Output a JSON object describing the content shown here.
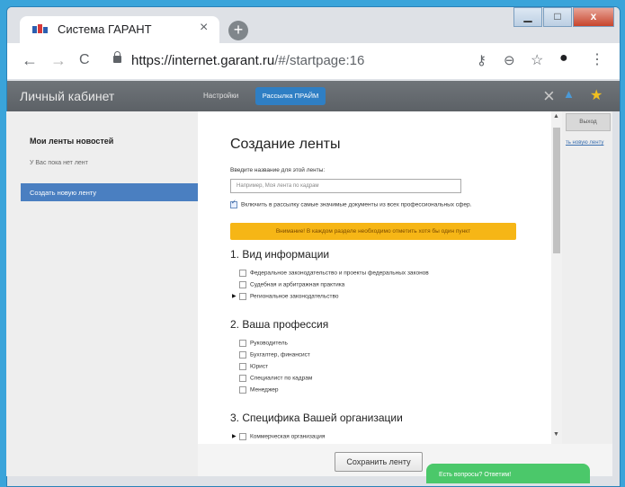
{
  "browser": {
    "tab_title": "Система ГАРАНТ",
    "tab_close": "×",
    "new_tab": "+",
    "url_host": "https://internet.garant.ru",
    "url_path": "/#/startpage:16",
    "back": "←",
    "forward": "→",
    "reload": "C",
    "win_min": "▁",
    "win_max": "□",
    "win_close": "x",
    "key_icon": "⚷",
    "zoom_icon": "⊖",
    "star_icon": "☆",
    "account_icon": "●",
    "menu_icon": "⋮"
  },
  "header": {
    "cabinet": "Личный кабинет",
    "settings": "Настройки",
    "mailing": "Рассылка ПРАЙМ",
    "close": "×",
    "star": "★",
    "person": "▲"
  },
  "sidebar": {
    "title": "Мои ленты новостей",
    "empty": "У Вас пока нет лент",
    "create": "Создать новую ленту"
  },
  "form": {
    "title": "Создание ленты",
    "name_label": "Введите название для этой ленты:",
    "name_placeholder": "Например, Моя лента по кадрам",
    "include_label": "Включить в рассылку самые значимые документы из всех профессиональных сфер.",
    "warning": "Внимание! В каждом разделе необходимо отметить хотя бы один пункт",
    "sections": [
      {
        "title": "1. Вид информации",
        "items": [
          "Федеральное законодательство и проекты федеральных законов",
          "Судебная и арбитражная практика",
          "Региональное законодательство"
        ]
      },
      {
        "title": "2. Ваша профессия",
        "items": [
          "Руководитель",
          "Бухгалтер, финансист",
          "Юрист",
          "Специалист по кадрам",
          "Менеджер"
        ]
      },
      {
        "title": "3. Специфика Вашей организации",
        "items": [
          "Коммерческая организация"
        ]
      }
    ],
    "save": "Сохранить ленту"
  },
  "right": {
    "exit": "Выход",
    "link": "ть новую ленту"
  },
  "chat": {
    "label": "Есть вопросы? Ответим!"
  },
  "colors": {
    "accent": "#4a7fc1",
    "warning": "#f6b616",
    "chat": "#4bc86a"
  }
}
